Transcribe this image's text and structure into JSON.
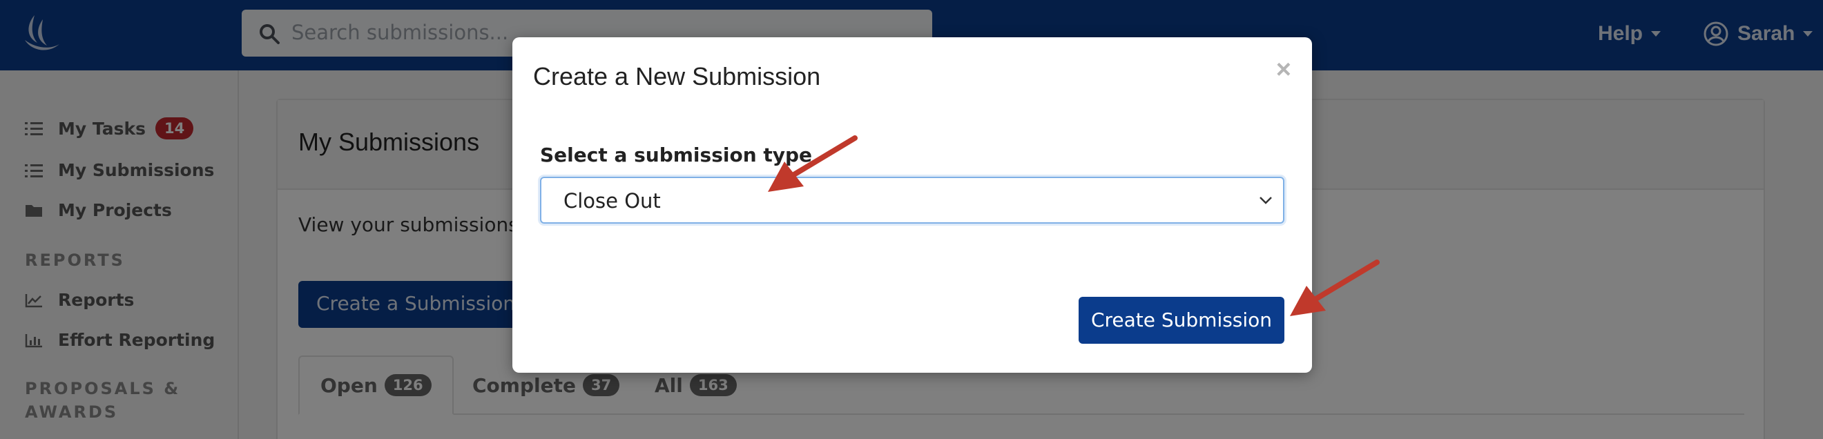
{
  "navbar": {
    "search_placeholder": "Search submissions...",
    "help_label": "Help",
    "user_label": "Sarah"
  },
  "sidebar": {
    "items": [
      {
        "label": "My Tasks",
        "badge": "14",
        "icon": "list-icon"
      },
      {
        "label": "My Submissions",
        "icon": "list-icon"
      },
      {
        "label": "My Projects",
        "icon": "folder-icon"
      }
    ],
    "reports_heading": "REPORTS",
    "reports_items": [
      {
        "label": "Reports",
        "icon": "line-chart-icon"
      },
      {
        "label": "Effort Reporting",
        "icon": "bar-chart-icon"
      }
    ],
    "proposals_heading_line1": "PROPOSALS &",
    "proposals_heading_line2": "AWARDS"
  },
  "main": {
    "title": "My Submissions",
    "description": "View your submissions a",
    "create_button": "Create a Submission",
    "tabs": [
      {
        "label": "Open",
        "count": "126"
      },
      {
        "label": "Complete",
        "count": "37"
      },
      {
        "label": "All",
        "count": "163"
      }
    ]
  },
  "modal": {
    "title": "Create a New Submission",
    "close_label": "×",
    "field_label": "Select a submission type",
    "selected_value": "Close Out",
    "submit_button": "Create Submission"
  },
  "colors": {
    "brand_blue": "#0b3c8c",
    "badge_red": "#c0282e",
    "annotation_arrow": "#c0392b"
  }
}
